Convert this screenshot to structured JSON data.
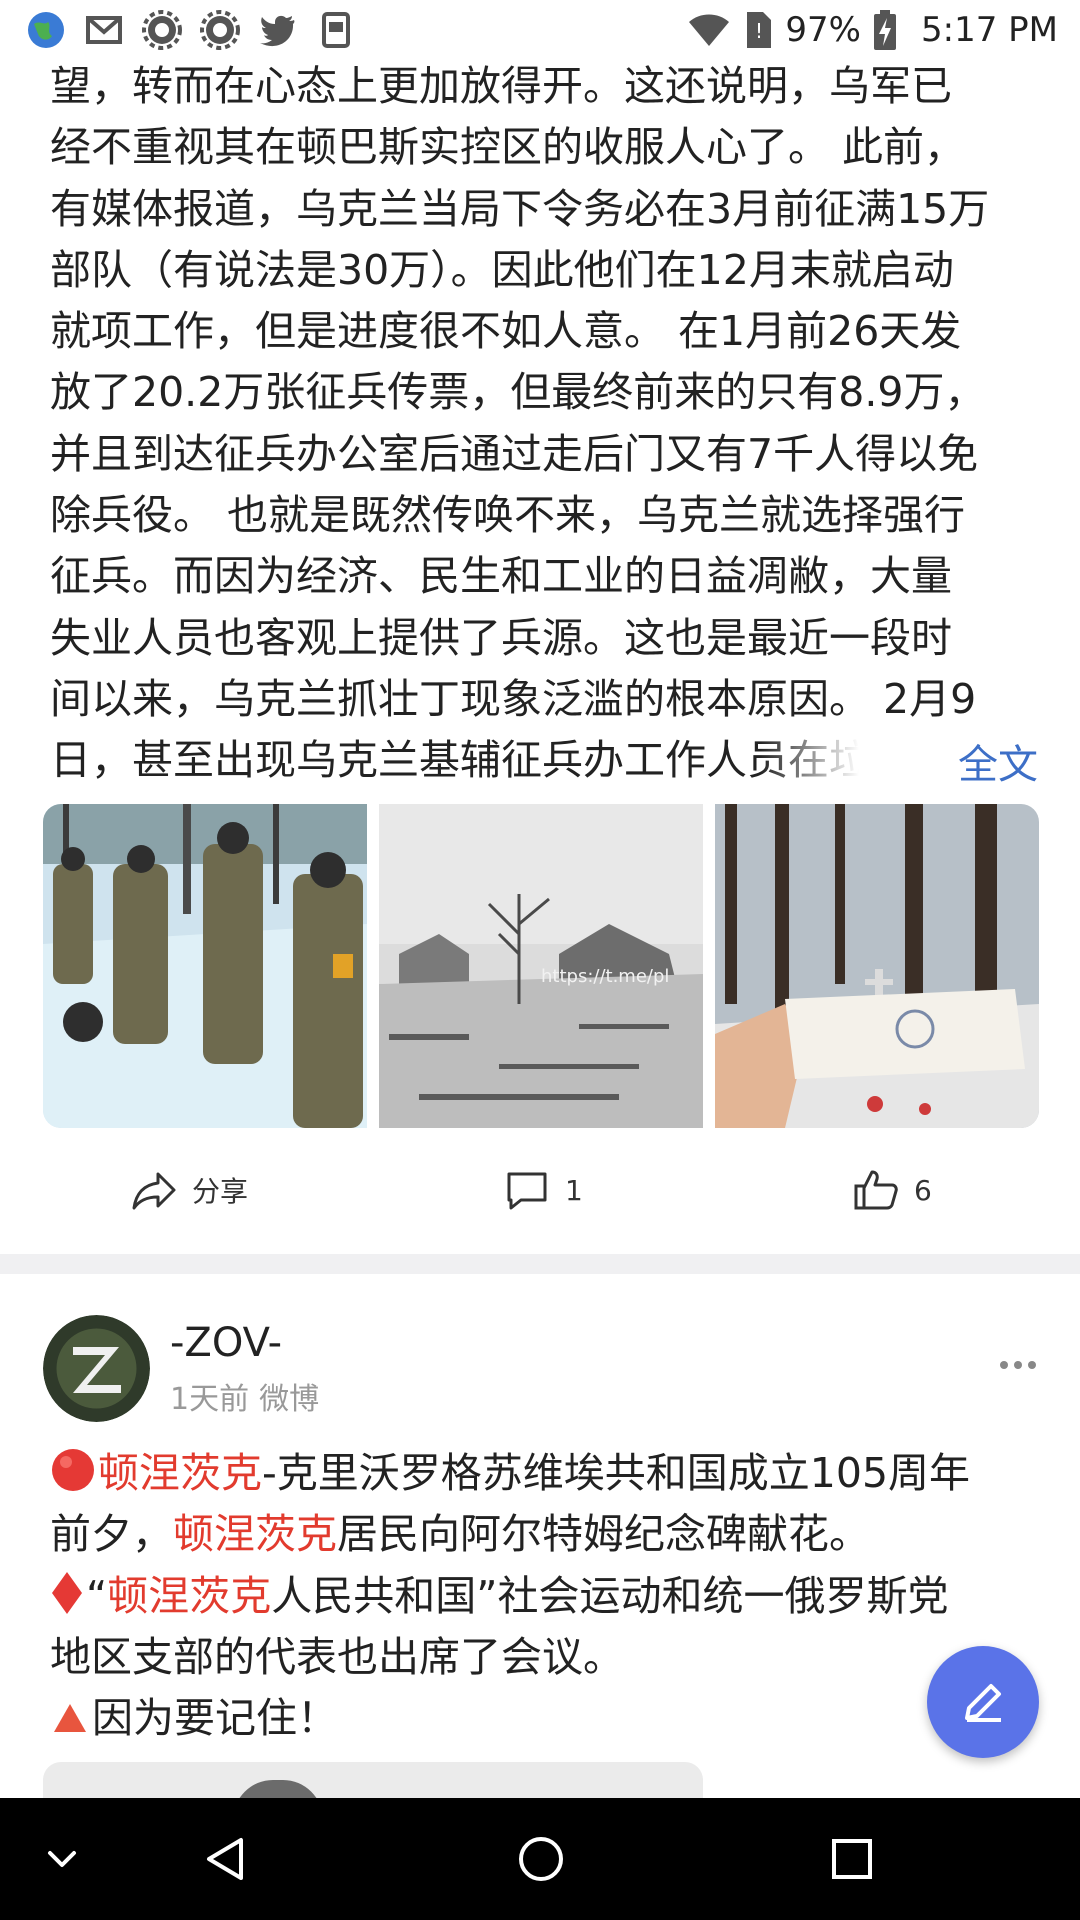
{
  "status_bar": {
    "time": "5:17 PM",
    "battery": "97%",
    "left_icons": [
      "globe-icon",
      "gmail-icon",
      "settings-icon",
      "settings-icon",
      "twitter-icon",
      "reader-icon"
    ],
    "right_icons": [
      "wifi-icon",
      "no-sim-icon",
      "battery-charging-icon"
    ]
  },
  "article": {
    "lines": [
      "望，转而在心态上更加放得开。这还说明，乌军已",
      "经不重视其在顿巴斯实控区的收服人心了。 此前，",
      "有媒体报道，乌克兰当局下令务必在3月前征满15万",
      "部队（有说法是30万）。因此他们在12月末就启动",
      "就项工作，但是进度很不如人意。 在1月前26天发",
      "放了20.2万张征兵传票，但最终前来的只有8.9万，",
      "并且到达征兵办公室后通过走后门又有7千人得以免",
      "除兵役。 也就是既然传唤不来，乌克兰就选择强行",
      "征兵。而因为经济、民生和工业的日益凋敝，大量",
      "失业人员也客观上提供了兵源。这也是最近一段时",
      "间以来，乌克兰抓壮丁现象泛滥的根本原因。 2月9",
      "日，甚至出现乌克兰基辅征兵办工作人员在垃"
    ],
    "full_text_label": "全文",
    "watermark": "https://t.me/pl",
    "images": [
      "soldiers-walking-in-snow",
      "destroyed-village-in-snow",
      "hand-holding-paper-in-cemetery"
    ]
  },
  "actions": {
    "share_label": "分享",
    "comment_count": "1",
    "like_count": "6"
  },
  "post": {
    "author": "-ZOV-",
    "time": "1天前",
    "source": "微博",
    "line1_pre": "",
    "line1_hl": "顿涅茨克",
    "line1_post": "-克里沃罗格苏维埃共和国成立105周年",
    "line2_pre": "前夕，",
    "line2_hl": "顿涅茨克",
    "line2_post": "居民向阿尔特姆纪念碑献花。",
    "line3_pre": "“",
    "line3_hl": "顿涅茨克",
    "line3_post": "人民共和国”社会运动和统一俄罗斯党",
    "line4": "地区支部的代表也出席了会议。",
    "line5": "因为要记住！",
    "colors": {
      "highlight": "#e23b2e",
      "link": "#3d6fc7",
      "fab": "#5a73e8"
    }
  }
}
